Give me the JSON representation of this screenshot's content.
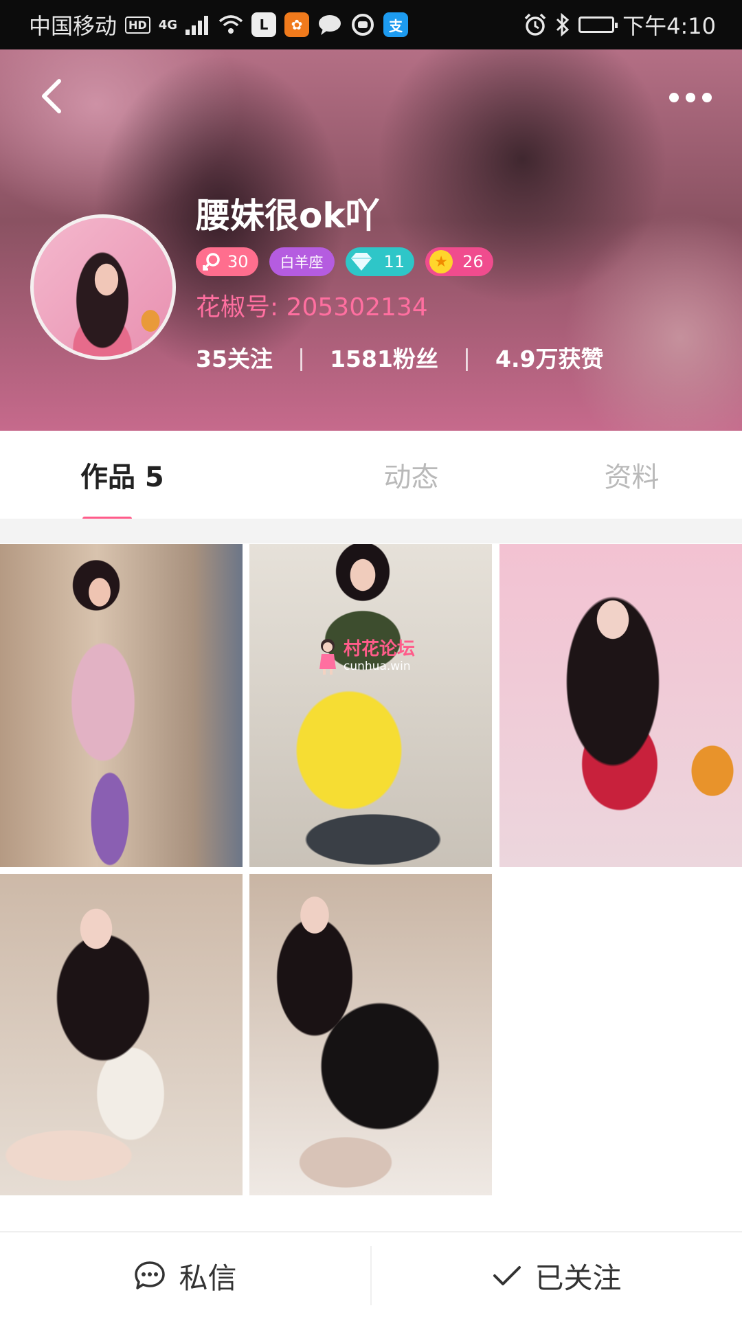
{
  "status_bar": {
    "carrier": "中国移动",
    "hd": "HD",
    "network": "4G",
    "app_l": "L",
    "time": "下午4:10"
  },
  "profile": {
    "name": "腰妹很ok吖",
    "badges": {
      "gender_level": "30",
      "zodiac": "白羊座",
      "diamond": "11",
      "star": "26"
    },
    "huajiao_id": "花椒号: 205302134",
    "stats": {
      "following": "35关注",
      "fans": "1581粉丝",
      "likes": "4.9万获赞"
    }
  },
  "tabs": [
    {
      "label": "作品 5",
      "active": true
    },
    {
      "label": "动态",
      "active": false
    },
    {
      "label": "资料",
      "active": false
    }
  ],
  "watermark": {
    "title": "村花论坛",
    "url": "cunhua.win"
  },
  "bottom_bar": {
    "message_label": "私信",
    "follow_label": "已关注"
  },
  "colors": {
    "accent": "#ff5c8a",
    "id_text": "#ff6fa0"
  },
  "icons": [
    "back-icon",
    "more-icon",
    "chat-icon",
    "check-icon",
    "diamond-icon",
    "star-icon",
    "gender-icon"
  ]
}
